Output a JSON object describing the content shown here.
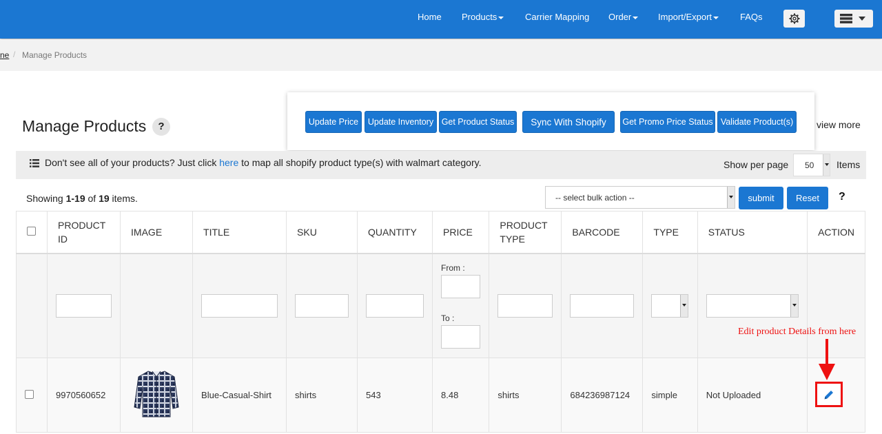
{
  "nav": {
    "home": "Home",
    "products": "Products",
    "carrier_mapping": "Carrier Mapping",
    "order": "Order",
    "import_export": "Import/Export",
    "faqs": "FAQs"
  },
  "breadcrumb": {
    "home": "ne",
    "separator": "/",
    "current": "Manage Products"
  },
  "page": {
    "title": "Manage Products",
    "help": "?",
    "view_more": "view more"
  },
  "actions": {
    "update_price": "Update Price",
    "update_inventory": "Update Inventory",
    "get_product_status": "Get Product Status",
    "sync_with_shopify": "Sync With Shopify",
    "get_promo_price_status": "Get Promo Price Status",
    "validate_products": "Validate Product(s)"
  },
  "info": {
    "text_before": "Don't see all of your products? Just click ",
    "link": "here",
    "text_after": " to map all shopify product type(s) with walmart category.",
    "show_per_page": "Show per page",
    "per_page_value": "50",
    "items": "Items"
  },
  "summary": {
    "prefix": "Showing ",
    "range": "1-19",
    "of": " of ",
    "total": "19",
    "suffix": " items."
  },
  "bulk": {
    "placeholder": "-- select bulk action --",
    "submit": "submit",
    "reset": "Reset",
    "help": "?"
  },
  "table": {
    "headers": {
      "product_id": "PRODUCT ID",
      "image": "IMAGE",
      "title": "TITLE",
      "sku": "SKU",
      "quantity": "QUANTITY",
      "price": "PRICE",
      "product_type": "PRODUCT TYPE",
      "barcode": "BARCODE",
      "type": "TYPE",
      "status": "STATUS",
      "action": "ACTION"
    },
    "filter": {
      "price_from": "From :",
      "price_to": "To :"
    },
    "rows": [
      {
        "product_id": "9970560652",
        "title": "Blue-Casual-Shirt",
        "sku": "shirts",
        "quantity": "543",
        "price": "8.48",
        "product_type": "shirts",
        "barcode": "684236987124",
        "type": "simple",
        "status": "Not Uploaded"
      }
    ]
  },
  "annotation": {
    "text": "Edit product Details from here"
  },
  "colors": {
    "primary": "#1b77d2",
    "annotation": "#ee1111",
    "status_not_uploaded": "#dd1111"
  }
}
